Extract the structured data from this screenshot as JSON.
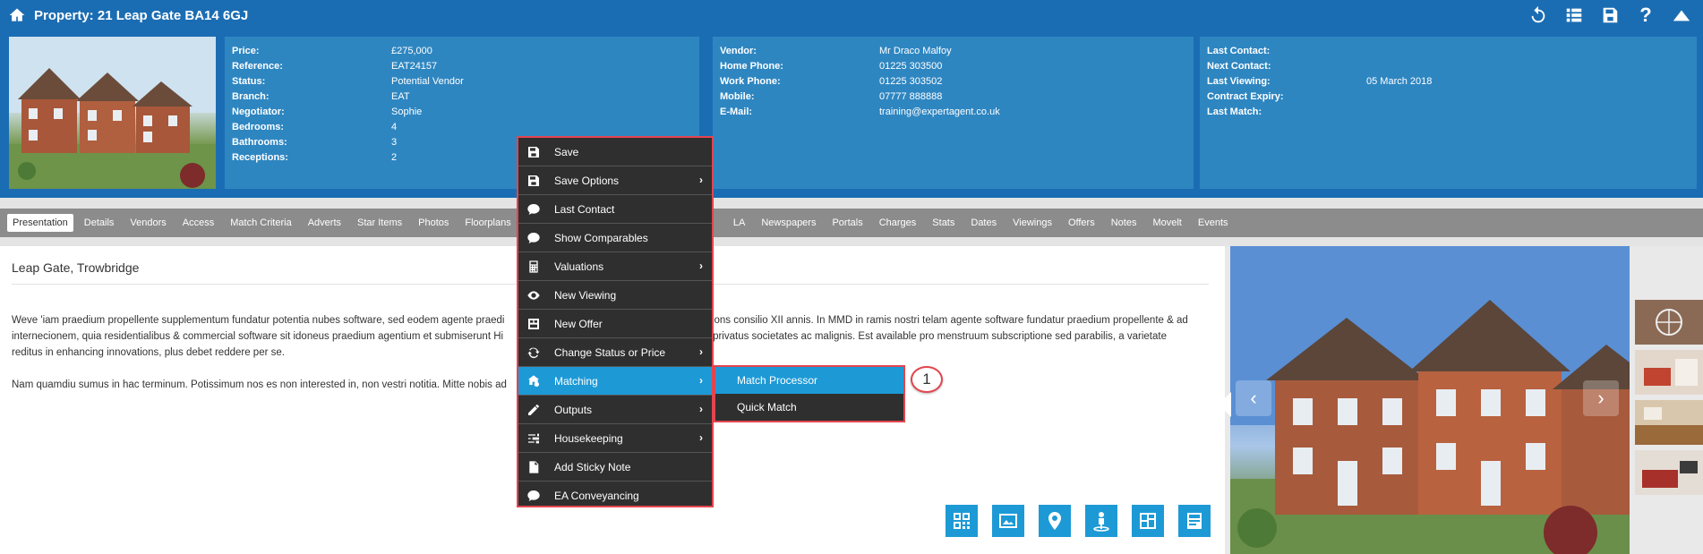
{
  "titlebar": {
    "title": "Property: 21 Leap Gate BA14 6GJ",
    "icons": [
      "home-icon",
      "undo-icon",
      "list-icon",
      "save-icon",
      "help-icon",
      "collapse-icon"
    ]
  },
  "property_panel": {
    "rows": [
      {
        "label": "Price:",
        "value": "£275,000"
      },
      {
        "label": "Reference:",
        "value": "EAT24157"
      },
      {
        "label": "Status:",
        "value": "Potential Vendor"
      },
      {
        "label": "Branch:",
        "value": "EAT"
      },
      {
        "label": "Negotiator:",
        "value": "Sophie"
      },
      {
        "label": "Bedrooms:",
        "value": "4"
      },
      {
        "label": "Bathrooms:",
        "value": "3"
      },
      {
        "label": "Receptions:",
        "value": "2"
      }
    ]
  },
  "vendor_panel": {
    "rows": [
      {
        "label": "Vendor:",
        "value": "Mr Draco Malfoy"
      },
      {
        "label": "Home Phone:",
        "value": "01225 303500"
      },
      {
        "label": "Work Phone:",
        "value": "01225 303502"
      },
      {
        "label": "Mobile:",
        "value": "07777 888888"
      },
      {
        "label": "E-Mail:",
        "value": "training@expertagent.co.uk"
      }
    ]
  },
  "contact_panel": {
    "rows": [
      {
        "label": "Last Contact:",
        "value": ""
      },
      {
        "label": "Next Contact:",
        "value": ""
      },
      {
        "label": "Last Viewing:",
        "value": "05 March 2018"
      },
      {
        "label": "Contract Expiry:",
        "value": ""
      },
      {
        "label": "Last Match:",
        "value": ""
      }
    ]
  },
  "tabs": [
    "Presentation",
    "Details",
    "Vendors",
    "Access",
    "Match Criteria",
    "Adverts",
    "Star Items",
    "Photos",
    "Floorplans",
    "L",
    "LA",
    "Newspapers",
    "Portals",
    "Charges",
    "Stats",
    "Dates",
    "Viewings",
    "Offers",
    "Notes",
    "Movelt",
    "Events"
  ],
  "content": {
    "title": "Leap Gate, Trowbridge",
    "para1_left": "Weve 'iam praedium propellente supplementum fundatur potentia nubes software, sed eodem agente praedi",
    "para1_right": "ons consilio XII annis. In MMD in ramis nostri telam agente software fundatur praedium propellente & ad",
    "para2_left": "internecionem, quia residentialibus & commercial software sit idoneus praedium agentium et submiserunt Hi",
    "para2_right": "privatus societates ac malignis. Est available pro menstruum subscriptione sed parabilis, a varietate",
    "para3": "reditus in enhancing innovations, plus debet reddere per se.",
    "para4": "Nam quamdiu sumus in hac terminum. Potissimum nos es non interested in, non vestri notitia. Mitte nobis ad"
  },
  "context_menu": {
    "items": [
      {
        "label": "Save",
        "icon": "save-icon",
        "submenu": false
      },
      {
        "label": "Save Options",
        "icon": "save-icon",
        "submenu": true
      },
      {
        "label": "Last Contact",
        "icon": "speech-bubble-icon",
        "submenu": false
      },
      {
        "label": "Show Comparables",
        "icon": "speech-bubble-icon",
        "submenu": false
      },
      {
        "label": "Valuations",
        "icon": "calculator-icon",
        "submenu": true
      },
      {
        "label": "New Viewing",
        "icon": "eye-icon",
        "submenu": false
      },
      {
        "label": "New Offer",
        "icon": "offer-icon",
        "submenu": false
      },
      {
        "label": "Change Status or Price",
        "icon": "refresh-icon",
        "submenu": true
      },
      {
        "label": "Matching",
        "icon": "matching-icon",
        "submenu": true,
        "highlighted": true
      },
      {
        "label": "Outputs",
        "icon": "pencil-icon",
        "submenu": true
      },
      {
        "label": "Housekeeping",
        "icon": "sliders-icon",
        "submenu": true
      },
      {
        "label": "Add Sticky Note",
        "icon": "document-icon",
        "submenu": false
      },
      {
        "label": "EA Conveyancing",
        "icon": "speech-bubble-icon",
        "submenu": false
      }
    ]
  },
  "submenu": {
    "items": [
      "Match Processor",
      "Quick Match"
    ]
  },
  "callout": "1",
  "colors": {
    "header_blue": "#1b6db3",
    "panel_blue": "#2e86c1",
    "highlight_blue": "#1d9ad6",
    "menu_dark": "#2f2f2f",
    "callout_red": "#e3454f"
  }
}
